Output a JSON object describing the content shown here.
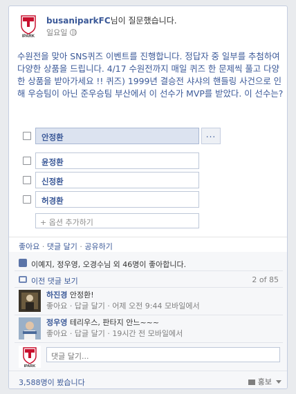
{
  "post": {
    "author": "busaniparkFC",
    "action_suffix": "님이 질문했습니다.",
    "time": "일요일",
    "question": "수원전을 맞아 SNS퀴즈 이벤트를 진행합니다. 정답자 중 일부를 추첨하여 다양한 상품을 드립니다. 4/17 수원전까지 매일 퀴즈 한 문제씩 풀고 다양한 상품을 받아가세요 !! 퀴즈) 1999년 결승전 샤샤의 핸들링 사건으로 인해 우승팀이 아닌 준우승팀 부산에서 이 선수가 MVP를 받았다. 이 선수는?",
    "logo_text": "IPARK"
  },
  "poll": {
    "options": [
      "안정환",
      "윤정환",
      "신정환",
      "허경환"
    ],
    "more_label": "...",
    "add_option": "+ 옵션 추가하기"
  },
  "actions": {
    "like": "좋아요",
    "comment": "댓글 달기",
    "share": "공유하기",
    "separator": " · "
  },
  "likes": {
    "text": "이예지, 정우영, 오경수님 외 46명이 좋아합니다."
  },
  "previous": {
    "label": "이전 댓글 보기",
    "count": "2 of 85"
  },
  "comments": [
    {
      "name": "하진경",
      "text": "안정환!",
      "meta": "좋아요 · 답글 달기 · 어제 오전 9:44 모바일에서"
    },
    {
      "name": "정우영",
      "text": "테리우스, 판타지 안느~~~",
      "meta": "좋아요 · 답글 달기 · 19시간 전 모바일에서"
    }
  ],
  "composer": {
    "placeholder": "댓글 달기..."
  },
  "footer": {
    "views": "3,588명이 봤습니다",
    "promote": "홍보"
  },
  "colors": {
    "link": "#3b5998",
    "muted": "#7f7f7f",
    "panel_bg": "#f6f7f9",
    "selected_option_bg": "#dce3f0",
    "logo_red": "#c8102e"
  },
  "icons": {
    "audience": "globe-icon",
    "likes": "thumbs-up-icon",
    "previous_comments": "comment-bubble-icon",
    "promote": "megaphone-icon"
  }
}
